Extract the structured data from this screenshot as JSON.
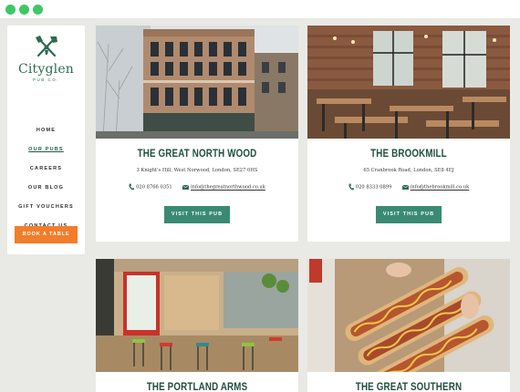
{
  "window": {
    "controls": [
      "close",
      "minimize",
      "maximize"
    ]
  },
  "brand": {
    "name": "Cityglen",
    "tagline": "PUB CO.",
    "color": "#2d6b52"
  },
  "nav": {
    "items": [
      {
        "label": "HOME",
        "active": false
      },
      {
        "label": "OUR PUBS",
        "active": true
      },
      {
        "label": "CAREERS",
        "active": false
      },
      {
        "label": "OUR BLOG",
        "active": false
      },
      {
        "label": "GIFT VOUCHERS",
        "active": false
      },
      {
        "label": "CONTACT US",
        "active": false
      }
    ],
    "cta_label": "BOOK A TABLE"
  },
  "colors": {
    "accent": "#f27d2a",
    "button": "#3a8a73",
    "title": "#1f4f3d",
    "background": "#e9e9e5"
  },
  "pubs": [
    {
      "name": "THE GREAT NORTH WOOD",
      "address": "3 Knight's Hill, West Norwood, London, SE27 0HS",
      "phone": "020 8766 0351",
      "email": "info@thegreatnorthwood.co.uk",
      "button": "VISIT THIS PUB"
    },
    {
      "name": "THE BROOKMILL",
      "address": "65 Cranbrook Road, London, SE8 4EJ",
      "phone": "020 8333 0899",
      "email": "info@thebrookmill.co.uk",
      "button": "VISIT THIS PUB"
    },
    {
      "name": "THE PORTLAND ARMS"
    },
    {
      "name": "THE GREAT SOUTHERN"
    }
  ]
}
